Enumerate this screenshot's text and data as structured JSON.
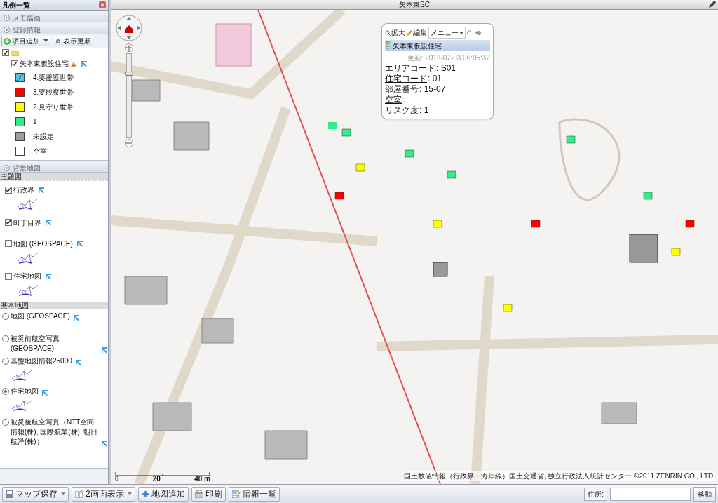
{
  "legend_panel": {
    "title": "凡例一覧",
    "memo_section": {
      "title": "メモ描画",
      "expanded": false
    },
    "registered_section": {
      "title": "登録情報",
      "expanded": true,
      "buttons": [
        "項目追加",
        "表示更新"
      ],
      "folder_checked": true,
      "layer": {
        "label": "矢本東仮設住宅",
        "checked": true
      },
      "legend": [
        {
          "label": "4.要援護世帯",
          "color": "#4fc3e8",
          "kind": "hatched"
        },
        {
          "label": "3.要観察世帯",
          "color": "#ff0000",
          "kind": "plain"
        },
        {
          "label": "2.見守り世帯",
          "color": "#ffff00",
          "kind": "plain"
        },
        {
          "label": "1",
          "color": "#33ee88",
          "kind": "plain"
        },
        {
          "label": "未設定",
          "color": "#a0a0a0",
          "kind": "plain"
        },
        {
          "label": "空室",
          "color": "#ffffff",
          "kind": "plain"
        }
      ]
    },
    "background_section": {
      "title": "背景地図",
      "expanded": true,
      "theme_group": {
        "title": "主題図",
        "items": [
          {
            "label": "行政界",
            "checked": true,
            "thumbnail": true
          },
          {
            "label": "町丁目界",
            "checked": true,
            "thumbnail": false
          },
          {
            "label": "地図 (GEOSPACE)",
            "checked": false,
            "thumbnail": true
          },
          {
            "label": "住宅地図",
            "checked": false,
            "thumbnail": true
          }
        ]
      },
      "base_group": {
        "title": "基本地図",
        "items": [
          {
            "label": "地図 (GEOSPACE)",
            "selected": false,
            "thumbnail": false
          },
          {
            "label": "被災前航空写真 (GEOSPACE)",
            "selected": false,
            "thumbnail": false
          },
          {
            "label": "基盤地図情報25000",
            "selected": false,
            "thumbnail": true
          },
          {
            "label": "住宅地図",
            "selected": true,
            "thumbnail": true
          },
          {
            "label": "被災後航空写真（NTT空間情報(株), 国際航業(株), 朝日航洋(株)）",
            "selected": false,
            "thumbnail": false
          }
        ]
      }
    }
  },
  "map": {
    "title": "矢本東SC",
    "zoom": {
      "level": 0.78
    },
    "popup": {
      "tools": [
        "拡大",
        "編集",
        "メニュー"
      ],
      "title": "矢本東仮設住宅",
      "updated": "更新: 2012-07-03 06:05:32",
      "fields": [
        {
          "label": "エリアコード",
          "value": ": S01"
        },
        {
          "label": "住宅コード",
          "value": ": 01"
        },
        {
          "label": "部屋番号",
          "value": ": 15-07"
        },
        {
          "label": "空室",
          "value": ":"
        },
        {
          "label": "リスク度",
          "value": ": 1"
        }
      ]
    },
    "scale": [
      "0",
      "20",
      "40 m"
    ],
    "attribution": "国土数値情報（行政界・海岸線）国土交通省, 独立行政法人統計センター ©2011 ZENRIN CO., LTD."
  },
  "toolbar": {
    "buttons": [
      {
        "label": "マップ保存",
        "dropdown": true
      },
      {
        "label": "2画面表示",
        "dropdown": true
      },
      {
        "label": "地図追加",
        "dropdown": false
      },
      {
        "label": "印刷",
        "dropdown": false
      },
      {
        "label": "情報一覧",
        "dropdown": false
      }
    ],
    "address_label": "住所:",
    "go_button": "移動"
  }
}
